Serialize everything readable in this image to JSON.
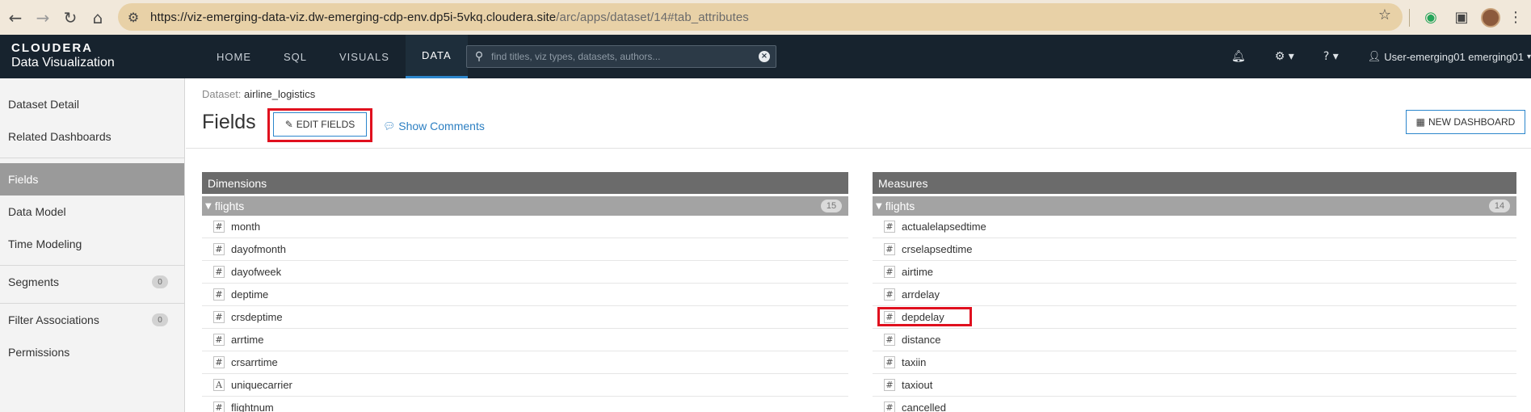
{
  "browser": {
    "url_base": "https://viz-emerging-data-viz.dw-emerging-cdp-env.dp5i-5vkq.cloudera.site",
    "url_path": "/arc/apps/dataset/14#tab_attributes"
  },
  "header": {
    "brand_name": "CLOUDERA",
    "brand_sub": "Data Visualization",
    "tabs": [
      {
        "label": "HOME"
      },
      {
        "label": "SQL"
      },
      {
        "label": "VISUALS"
      },
      {
        "label": "DATA"
      }
    ],
    "search_placeholder": "find titles, viz types, datasets, authors...",
    "user": "User-emerging01 emerging01"
  },
  "sidebar": {
    "items": [
      {
        "label": "Dataset Detail"
      },
      {
        "label": "Related Dashboards"
      },
      {
        "label": "Fields"
      },
      {
        "label": "Data Model"
      },
      {
        "label": "Time Modeling"
      },
      {
        "label": "Segments",
        "badge": "0"
      },
      {
        "label": "Filter Associations",
        "badge": "0"
      },
      {
        "label": "Permissions"
      }
    ]
  },
  "main": {
    "breadcrumb_label": "Dataset:",
    "dataset_name": "airline_logistics",
    "title": "Fields",
    "edit_fields_label": "EDIT FIELDS",
    "show_comments_label": "Show Comments",
    "new_dashboard_label": "NEW DASHBOARD"
  },
  "dimensions": {
    "title": "Dimensions",
    "group_name": "flights",
    "count": "15",
    "fields": [
      {
        "type": "#",
        "name": "month"
      },
      {
        "type": "#",
        "name": "dayofmonth"
      },
      {
        "type": "#",
        "name": "dayofweek"
      },
      {
        "type": "#",
        "name": "deptime"
      },
      {
        "type": "#",
        "name": "crsdeptime"
      },
      {
        "type": "#",
        "name": "arrtime"
      },
      {
        "type": "#",
        "name": "crsarrtime"
      },
      {
        "type": "A",
        "name": "uniquecarrier"
      },
      {
        "type": "#",
        "name": "flightnum"
      }
    ]
  },
  "measures": {
    "title": "Measures",
    "group_name": "flights",
    "count": "14",
    "fields": [
      {
        "type": "#",
        "name": "actualelapsedtime"
      },
      {
        "type": "#",
        "name": "crselapsedtime"
      },
      {
        "type": "#",
        "name": "airtime"
      },
      {
        "type": "#",
        "name": "arrdelay"
      },
      {
        "type": "#",
        "name": "depdelay"
      },
      {
        "type": "#",
        "name": "distance"
      },
      {
        "type": "#",
        "name": "taxiin"
      },
      {
        "type": "#",
        "name": "taxiout"
      },
      {
        "type": "#",
        "name": "cancelled"
      }
    ]
  }
}
